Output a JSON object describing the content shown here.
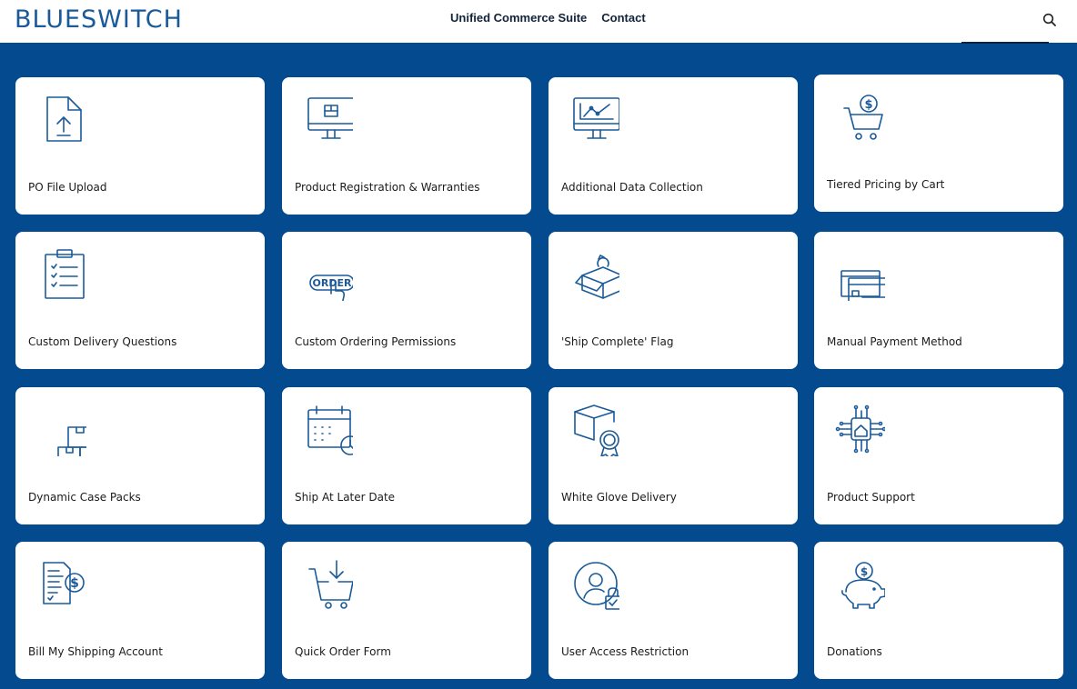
{
  "header": {
    "logo_text": "BLUESWITCH",
    "nav": [
      "Unified Commerce Suite",
      "Contact"
    ]
  },
  "cards": [
    {
      "label": "PO File Upload",
      "icon": "file-upload-icon"
    },
    {
      "label": "Product Registration & Warranties",
      "icon": "computer-box-icon"
    },
    {
      "label": "Additional Data Collection",
      "icon": "monitor-chart-icon"
    },
    {
      "label": "Tiered Pricing by Cart",
      "icon": "cart-dollar-icon"
    },
    {
      "label": "Custom Delivery Questions",
      "icon": "clipboard-checklist-icon"
    },
    {
      "label": "Custom Ordering Permissions",
      "icon": "order-button-icon",
      "icon_text": "ORDER"
    },
    {
      "label": "'Ship Complete' Flag",
      "icon": "open-box-icon"
    },
    {
      "label": "Manual Payment Method",
      "icon": "credit-cards-icon"
    },
    {
      "label": "Dynamic Case Packs",
      "icon": "stacked-boxes-icon"
    },
    {
      "label": "Ship At Later Date",
      "icon": "calendar-clock-icon"
    },
    {
      "label": "White Glove Delivery",
      "icon": "box-badge-icon"
    },
    {
      "label": "Product Support",
      "icon": "home-circuit-icon"
    },
    {
      "label": "Bill My Shipping Account",
      "icon": "invoice-dollar-icon"
    },
    {
      "label": "Quick Order Form",
      "icon": "cart-download-icon"
    },
    {
      "label": "User Access Restriction",
      "icon": "user-lock-icon"
    },
    {
      "label": "Donations",
      "icon": "piggy-bank-icon"
    }
  ],
  "colors": {
    "background": "#044a8f",
    "icon": "#1a5a99",
    "card": "#ffffff"
  }
}
